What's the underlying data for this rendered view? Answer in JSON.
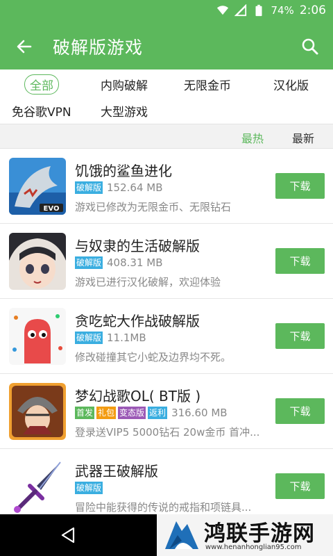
{
  "status_bar": {
    "battery": "74%",
    "time": "2:06",
    "icons": [
      "wifi-icon",
      "signal-icon",
      "battery-icon"
    ]
  },
  "app_bar": {
    "title": "破解版游戏",
    "icons": [
      "back-arrow-icon",
      "search-icon"
    ]
  },
  "categories": [
    {
      "label": "全部",
      "active": true
    },
    {
      "label": "内购破解"
    },
    {
      "label": "无限金币"
    },
    {
      "label": "汉化版"
    },
    {
      "label": "免谷歌VPN"
    },
    {
      "label": "大型游戏"
    }
  ],
  "sort": {
    "hot": "最热",
    "newest": "最新",
    "active": "hot"
  },
  "download_label": "下载",
  "games": [
    {
      "name": "饥饿的鲨鱼进化",
      "tags": [
        "破解版"
      ],
      "size": "152.64 MB",
      "desc": "游戏已修改为无限金币、无限钻石"
    },
    {
      "name": "与奴隶的生活破解版",
      "tags": [
        "破解版"
      ],
      "size": "408.31 MB",
      "desc": "游戏已进行汉化破解，欢迎体验"
    },
    {
      "name": "贪吃蛇大作战破解版",
      "tags": [
        "破解版"
      ],
      "size": "11.1MB",
      "desc": "修改碰撞其它小蛇及边界均不死。"
    },
    {
      "name": "梦幻战歌OL( BT版 )",
      "tags": [
        "首发",
        "礼包",
        "变态版",
        "返利"
      ],
      "size": "316.60 MB",
      "desc": "登录送VIP5 5000钻石 20w金币 首冲..."
    },
    {
      "name": "武器王破解版",
      "tags": [
        "破解版"
      ],
      "size": "",
      "desc": "冒险中能获得的传说的戒指和项链具..."
    }
  ],
  "colors": {
    "primary": "#5cb85c",
    "tag_crack": "#3aaee0",
    "tag_first": "#5cb85c",
    "tag_gift": "#f39c12",
    "tag_bt": "#9b59b6",
    "tag_rebate": "#3aaee0"
  },
  "watermark": {
    "title": "鸿联手游网",
    "url": "www.henanhonglian95.com"
  }
}
